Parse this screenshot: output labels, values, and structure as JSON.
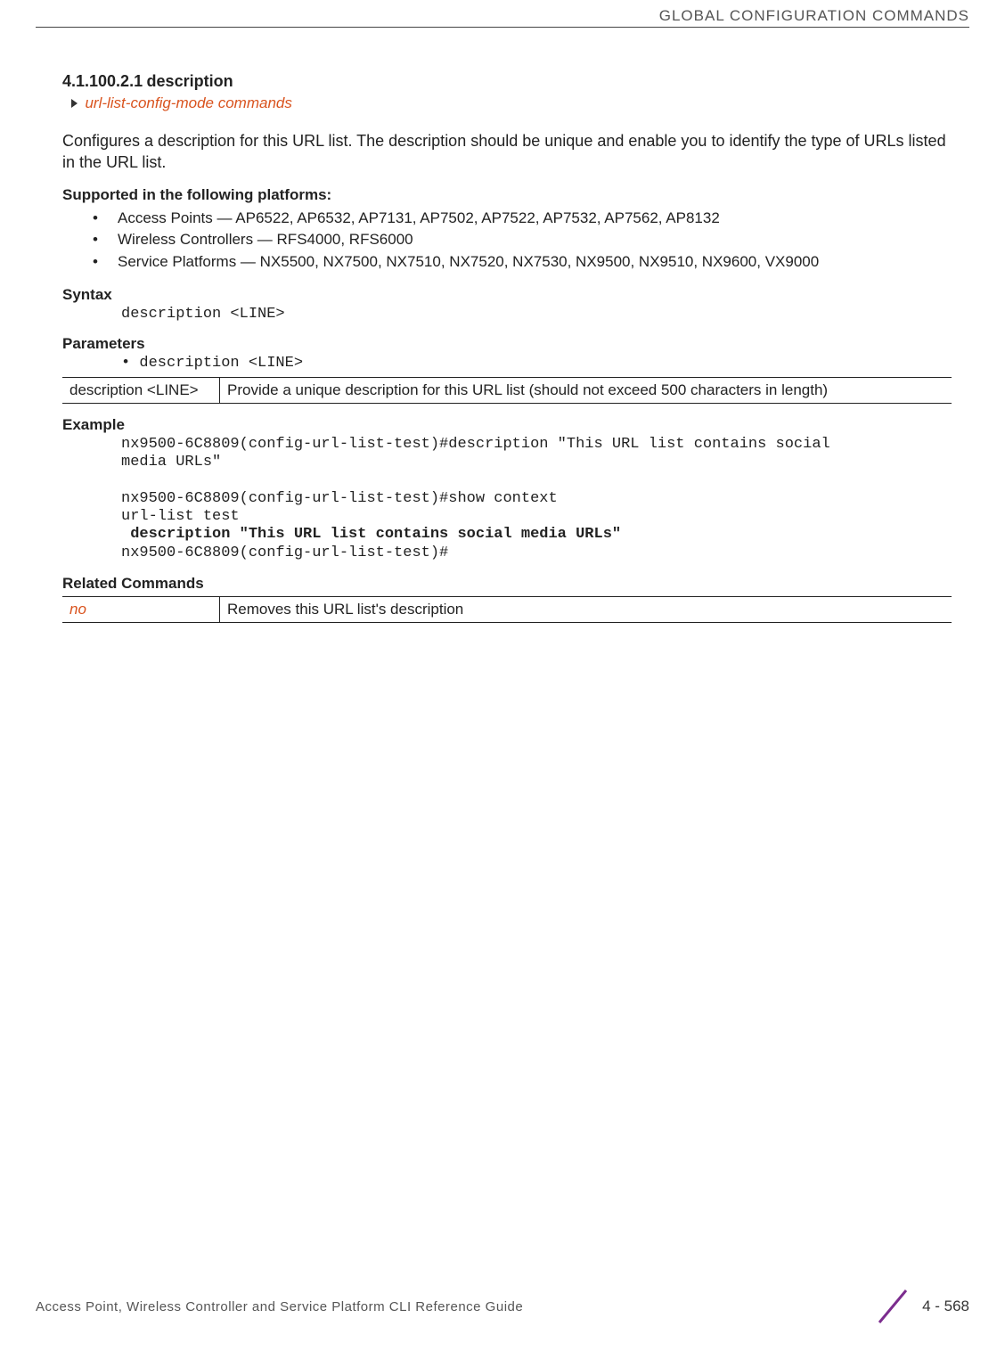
{
  "header": {
    "running_title": "GLOBAL CONFIGURATION COMMANDS"
  },
  "section": {
    "number": "4.1.100.2.1",
    "title": "description",
    "breadcrumb": "url-list-config-mode commands",
    "intro": "Configures a description for this URL list. The description should be unique and enable you to identify the type of URLs listed in the URL list."
  },
  "supported": {
    "heading": "Supported in the following platforms:",
    "items": [
      "Access Points — AP6522, AP6532, AP7131, AP7502, AP7522, AP7532, AP7562, AP8132",
      "Wireless Controllers — RFS4000, RFS6000",
      "Service Platforms — NX5500, NX7500, NX7510, NX7520, NX7530, NX9500, NX9510, NX9600, VX9000"
    ]
  },
  "syntax": {
    "heading": "Syntax",
    "text": "description <LINE>"
  },
  "parameters": {
    "heading": "Parameters",
    "bullet": "• description <LINE>",
    "table": {
      "col1": "description <LINE>",
      "col2": "Provide a unique description for this URL list (should not exceed 500 characters in length)"
    }
  },
  "example": {
    "heading": "Example",
    "line1": "nx9500-6C8809(config-url-list-test)#description \"This URL list contains social",
    "line2": "media URLs\"",
    "line3": "nx9500-6C8809(config-url-list-test)#show context",
    "line4": "url-list test",
    "line5_bold": " description \"This URL list contains social media URLs\"",
    "line6": "nx9500-6C8809(config-url-list-test)#"
  },
  "related": {
    "heading": "Related Commands",
    "table": {
      "col1": "no",
      "col2": "Removes this URL list's description"
    }
  },
  "footer": {
    "title": "Access Point, Wireless Controller and Service Platform CLI Reference Guide",
    "page": "4 - 568"
  }
}
